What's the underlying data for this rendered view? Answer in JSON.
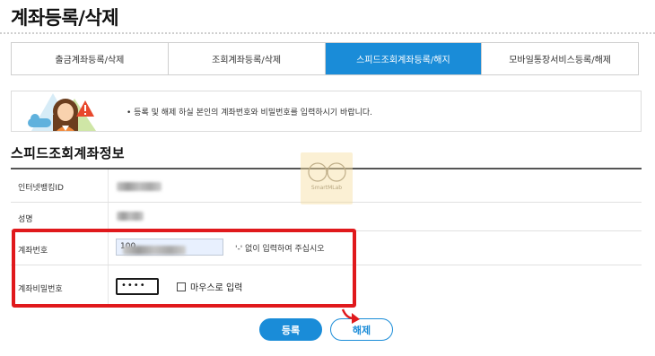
{
  "page": {
    "title": "계좌등록/삭제"
  },
  "tabs": [
    {
      "label": "출금계좌등록/삭제",
      "active": false
    },
    {
      "label": "조회계좌등록/삭제",
      "active": false
    },
    {
      "label": "스피드조회계좌등록/해지",
      "active": true
    },
    {
      "label": "모바일통장서비스등록/해제",
      "active": false
    }
  ],
  "notice": {
    "text": "• 등록 및 해제 하실 본인의 계좌번호와 비밀번호를 입력하시기 바랍니다."
  },
  "section": {
    "title": "스피드조회계좌정보"
  },
  "form": {
    "internet_banking_id_label": "인터넷뱅킹ID",
    "name_label": "성명",
    "account_number_label": "계좌번호",
    "account_number_value": "100",
    "account_number_hint": "'-' 없이 입력하여 주십시오",
    "account_password_label": "계좌비밀번호",
    "account_password_value": "••••",
    "mouse_input_label": "마우스로 입력",
    "mouse_input_checked": false
  },
  "buttons": {
    "register": "등록",
    "cancel": "해제"
  },
  "watermark": {
    "text": "SmartMLab"
  },
  "colors": {
    "accent": "#1a8cd8",
    "highlight": "#e0191c"
  }
}
